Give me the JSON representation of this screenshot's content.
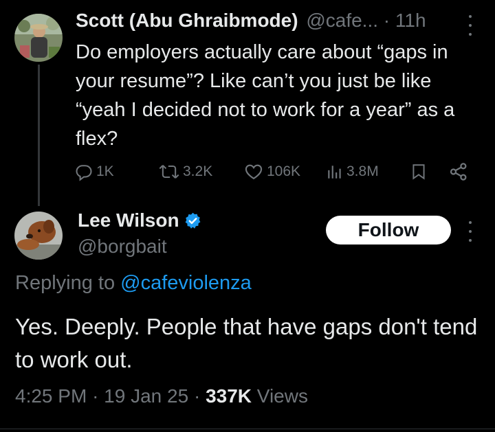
{
  "tweet1": {
    "author_name": "Scott (Abu Ghraibmode)",
    "handle": "@cafe...",
    "separator": "·",
    "time": "11h",
    "text": "Do employers actually care about “gaps in your resume”? Like can’t you just be like “yeah I decided not to work for a year” as a flex?",
    "actions": {
      "replies": "1K",
      "reposts": "3.2K",
      "likes": "106K",
      "views": "3.8M"
    }
  },
  "tweet2": {
    "author_name": "Lee Wilson",
    "handle": "@borgbait",
    "follow_label": "Follow",
    "replying_prefix": "Replying to",
    "replying_handle": "@cafeviolenza",
    "text": "Yes. Deeply. People that have gaps don't tend to work out.",
    "time": "4:25 PM",
    "date": "19 Jan 25",
    "views_count": "337K",
    "views_label": "Views",
    "separator": "·"
  },
  "icons": {
    "reply": "reply-icon",
    "repost": "repost-icon",
    "like": "heart-icon",
    "views": "analytics-icon",
    "bookmark": "bookmark-icon",
    "share": "share-icon",
    "verified": "verified-badge-icon",
    "more": "more-icon"
  },
  "colors": {
    "background": "#000000",
    "text": "#e7e9ea",
    "muted": "#71767b",
    "accent": "#1d9bf0"
  }
}
